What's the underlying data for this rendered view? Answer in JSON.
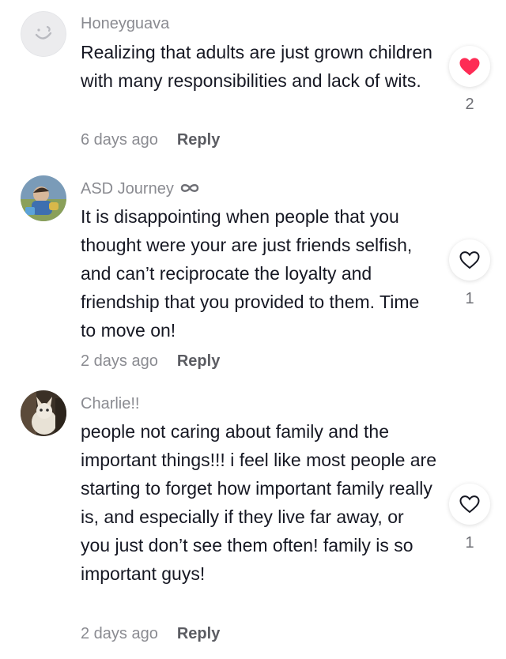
{
  "comments": [
    {
      "username": "Honeyguava",
      "text": "Realizing that adults are just grown children with many responsibilities and lack of wits.",
      "time": "6 days ago",
      "reply_label": "Reply",
      "likes": "2",
      "liked": true
    },
    {
      "username": "ASD Journey",
      "text": "It is disappointing when people that you thought were your are just friends selfish, and can’t reciprocate the loyalty and friendship that you provided to them. Time to move on!",
      "time": "2 days ago",
      "reply_label": "Reply",
      "likes": "1",
      "liked": false,
      "badge_icon": "infinity-icon"
    },
    {
      "username": "Charlie!!",
      "text": "people not caring about family and the important things!!! i feel like most people are starting to forget how important family really is, and especially if they live far away, or you just don’t see them often! family is so important guys!",
      "time": "2 days ago",
      "reply_label": "Reply",
      "likes": "1",
      "liked": false
    }
  ],
  "colors": {
    "liked_heart": "#fe2c55",
    "secondary_text": "#8a8b91",
    "primary_text": "#161823"
  }
}
